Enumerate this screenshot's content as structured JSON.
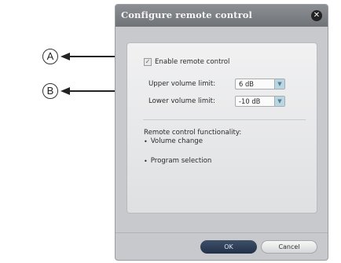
{
  "callouts": {
    "a": "A",
    "b": "B"
  },
  "dialog": {
    "title": "Configure remote control",
    "enable_label": "Enable remote control",
    "enable_checked": true,
    "upper_label": "Upper volume limit:",
    "upper_value": "6 dB",
    "lower_label": "Lower volume limit:",
    "lower_value": "-10 dB",
    "functionality_title": "Remote control functionality:",
    "functionality_items": [
      "Volume change",
      "Program selection"
    ],
    "ok_label": "OK",
    "cancel_label": "Cancel"
  }
}
